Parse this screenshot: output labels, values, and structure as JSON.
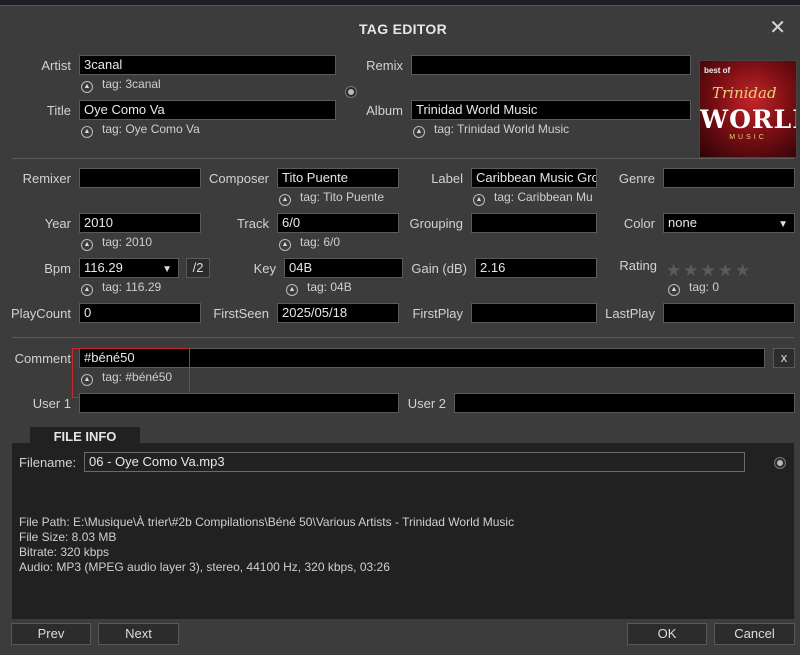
{
  "window": {
    "title": "TAG EDITOR"
  },
  "fields": {
    "artist": {
      "label": "Artist",
      "value": "3canal",
      "tag": "tag: 3canal"
    },
    "remix": {
      "label": "Remix",
      "value": ""
    },
    "title": {
      "label": "Title",
      "value": "Oye Como Va",
      "tag": "tag: Oye Como Va"
    },
    "album": {
      "label": "Album",
      "value": "Trinidad World Music",
      "tag": "tag: Trinidad World Music"
    },
    "remixer": {
      "label": "Remixer",
      "value": ""
    },
    "composer": {
      "label": "Composer",
      "value": "Tito Puente",
      "tag": "tag: Tito Puente"
    },
    "label": {
      "label": "Label",
      "value": "Caribbean Music Gro",
      "tag": "tag: Caribbean Mu"
    },
    "genre": {
      "label": "Genre",
      "value": ""
    },
    "year": {
      "label": "Year",
      "value": "2010",
      "tag": "tag: 2010"
    },
    "track": {
      "label": "Track",
      "value": "6/0",
      "tag": "tag: 6/0"
    },
    "grouping": {
      "label": "Grouping",
      "value": ""
    },
    "color": {
      "label": "Color",
      "value": "none"
    },
    "bpm": {
      "label": "Bpm",
      "value": "116.29",
      "tag": "tag: 116.29",
      "halve": "/2"
    },
    "key": {
      "label": "Key",
      "value": "04B",
      "tag": "tag: 04B"
    },
    "gain": {
      "label": "Gain (dB)",
      "value": "2.16"
    },
    "rating": {
      "label": "Rating",
      "value": 0,
      "max": 5,
      "tag": "tag: 0"
    },
    "playcount": {
      "label": "PlayCount",
      "value": "0"
    },
    "firstseen": {
      "label": "FirstSeen",
      "value": "2025/05/18"
    },
    "firstplay": {
      "label": "FirstPlay",
      "value": ""
    },
    "lastplay": {
      "label": "LastPlay",
      "value": ""
    },
    "comment": {
      "label": "Comment",
      "value": "#béné50",
      "tag": "tag: #béné50",
      "clear": "x"
    },
    "user1": {
      "label": "User 1",
      "value": ""
    },
    "user2": {
      "label": "User 2",
      "value": ""
    }
  },
  "artwork": {
    "line1": "best of",
    "line2": "Trinidad",
    "line3": "WORLD",
    "line4": "MUSIC"
  },
  "fileinfo": {
    "tab": "FILE INFO",
    "filename_label": "Filename:",
    "filename": "06 - Oye Como Va.mp3",
    "path": "File Path: E:\\Musique\\À trier\\#2b Compilations\\Béné 50\\Various Artists - Trinidad World Music",
    "size": "File Size: 8.03 MB",
    "bitrate": "Bitrate: 320 kbps",
    "audio": "Audio: MP3 (MPEG audio layer 3), stereo, 44100 Hz, 320 kbps, 03:26"
  },
  "buttons": {
    "prev": "Prev",
    "next": "Next",
    "ok": "OK",
    "cancel": "Cancel"
  },
  "colors": {
    "highlight": "#c8282a",
    "background": "#3c3c3c",
    "input": "#000000"
  },
  "icons": {
    "close": "close-icon",
    "tag": "tag-revert-icon",
    "star": "star-icon",
    "dropdown": "chevron-down-icon"
  }
}
